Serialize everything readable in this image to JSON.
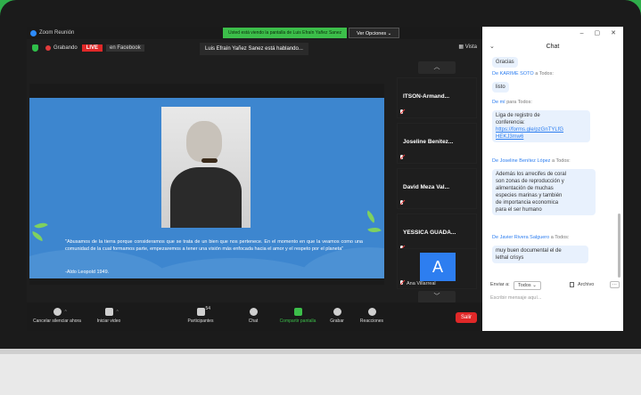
{
  "window": {
    "title": "Zoom Reunión",
    "share_notice": "Usted está viendo la pantalla de Luis Efraín Yañez Sanez",
    "view_options": "Ver Opciones ⌄"
  },
  "meeting": {
    "recording_label": "Grabando",
    "live_badge": "LIVE",
    "live_target": "en Facebook",
    "speaking_label": "Luis Efraín Yañez Sanez está hablando...",
    "view_label": "Vista"
  },
  "slide": {
    "quote": "\"Abusamos de la tierra porque consideramos que se trata de un bien que nos pertenece. En el momento en que la veamos como una comunidad de la cual formamos parte, empezaremos a tener una visión más enfocada hacia el amor y el respeto por el planeta\"",
    "author": "-Aldo Leopold 1949."
  },
  "participants": [
    {
      "name": "ITSON-Armand..."
    },
    {
      "name": "Joseline Benitez..."
    },
    {
      "name": "David Meza Val..."
    },
    {
      "name": "YESSICA GUADA..."
    },
    {
      "avatar_letter": "A",
      "name": "Ana Villarreal"
    }
  ],
  "toolbar": {
    "mute": "Cancelar silenciar ahora",
    "video": "Iniciar video",
    "participants": "Participantes",
    "participants_count": "54",
    "chat": "Chat",
    "share": "Compartir pantalla",
    "record": "Grabar",
    "reactions": "Reacciones",
    "leave": "Salir"
  },
  "chat": {
    "title": "Chat",
    "window_controls": [
      "–",
      "▢",
      "✕"
    ],
    "messages": [
      {
        "text": "Gracias"
      },
      {
        "sender": "KARIME SOTO",
        "to": "a Todos:",
        "text": "listo"
      },
      {
        "sender": "mí",
        "to": "para Todos:",
        "lines": [
          "Liga de registro de",
          "conferencia:"
        ],
        "link": [
          "https://forms.gle/pzGnTYLfG",
          "HEKJ3mw6"
        ]
      },
      {
        "sender": "Joseline Benítez López",
        "to": "a Todos:",
        "lines": [
          "Además los arrecifes de coral",
          "son zonas de reproducción y",
          "alimentación de muchas",
          "especies marinas y también",
          "de importancia economica",
          "para el ser humano"
        ]
      },
      {
        "sender": "Javier Rivera Salguero",
        "to": "a Todos:",
        "lines": [
          "muy buen documental el de",
          "lethal crisys"
        ]
      }
    ],
    "send_to_label": "Enviar a:",
    "send_to_value": "Todos ⌄",
    "file_label": "Archivo",
    "more_label": "···",
    "input_placeholder": "Escribir mensaje aquí..."
  }
}
